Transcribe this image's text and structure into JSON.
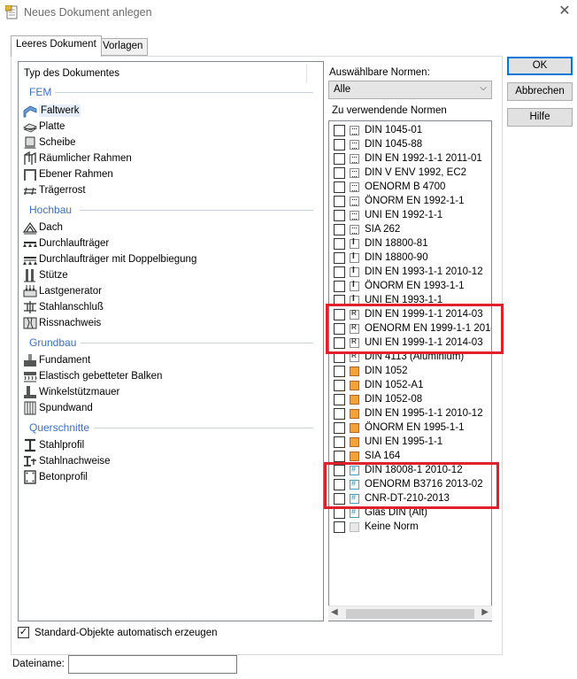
{
  "window": {
    "title": "Neues Dokument anlegen",
    "close_glyph": "✕"
  },
  "tabs": [
    {
      "label": "Leeres Dokument"
    },
    {
      "label": "Vorlagen"
    }
  ],
  "tree": {
    "header": "Typ des Dokumentes",
    "groups": [
      {
        "label": "FEM",
        "items": [
          "Faltwerk",
          "Platte",
          "Scheibe",
          "Räumlicher Rahmen",
          "Ebener Rahmen",
          "Trägerrost"
        ]
      },
      {
        "label": "Hochbau",
        "items": [
          "Dach",
          "Durchlaufträger",
          "Durchlaufträger mit Doppelbiegung",
          "Stütze",
          "Lastgenerator",
          "Stahlanschluß",
          "Rissnachweis"
        ]
      },
      {
        "label": "Grundbau",
        "items": [
          "Fundament",
          "Elastisch gebetteter Balken",
          "Winkelstützmauer",
          "Spundwand"
        ]
      },
      {
        "label": "Querschnitte",
        "items": [
          "Stahlprofil",
          "Stahlnachweise",
          "Betonprofil"
        ]
      }
    ],
    "selected": "Faltwerk"
  },
  "norms": {
    "available_label": "Auswählbare Normen:",
    "available_value": "Alle",
    "used_label": "Zu verwendende Normen",
    "items": [
      {
        "label": "DIN 1045-01",
        "icon": "concrete-icon"
      },
      {
        "label": "DIN 1045-88",
        "icon": "concrete-icon"
      },
      {
        "label": "DIN EN 1992-1-1 2011-01",
        "icon": "concrete-icon"
      },
      {
        "label": "DIN V ENV 1992, EC2",
        "icon": "concrete-icon"
      },
      {
        "label": "OENORM B 4700",
        "icon": "concrete-icon"
      },
      {
        "label": "ÖNORM EN 1992-1-1",
        "icon": "concrete-icon"
      },
      {
        "label": "UNI EN 1992-1-1",
        "icon": "concrete-icon"
      },
      {
        "label": "SIA 262",
        "icon": "concrete-icon"
      },
      {
        "label": "DIN 18800-81",
        "icon": "steel-icon"
      },
      {
        "label": "DIN 18800-90",
        "icon": "steel-icon"
      },
      {
        "label": "DIN EN 1993-1-1 2010-12",
        "icon": "steel-icon"
      },
      {
        "label": "ÖNORM EN 1993-1-1",
        "icon": "steel-icon"
      },
      {
        "label": "UNI EN 1993-1-1",
        "icon": "steel-icon"
      },
      {
        "label": "DIN EN 1999-1-1 2014-03",
        "icon": "aluminium-icon"
      },
      {
        "label": "OENORM EN 1999-1-1 2014-0",
        "icon": "aluminium-icon"
      },
      {
        "label": "UNI EN 1999-1-1 2014-03",
        "icon": "aluminium-icon"
      },
      {
        "label": "DIN 4113 (Aluminium)",
        "icon": "aluminium-icon"
      },
      {
        "label": "DIN 1052",
        "icon": "timber-icon"
      },
      {
        "label": "DIN 1052-A1",
        "icon": "timber-icon"
      },
      {
        "label": "DIN 1052-08",
        "icon": "timber-icon"
      },
      {
        "label": "DIN EN 1995-1-1 2010-12",
        "icon": "timber-icon"
      },
      {
        "label": "ÖNORM EN 1995-1-1",
        "icon": "timber-icon"
      },
      {
        "label": "UNI EN 1995-1-1",
        "icon": "timber-icon"
      },
      {
        "label": "SIA 164",
        "icon": "timber-icon"
      },
      {
        "label": "DIN 18008-1 2010-12",
        "icon": "glass-icon"
      },
      {
        "label": "OENORM B3716 2013-02",
        "icon": "glass-icon"
      },
      {
        "label": "CNR-DT-210-2013",
        "icon": "glass-icon"
      },
      {
        "label": "Glas DIN (Alt)",
        "icon": "glass-icon"
      },
      {
        "label": "Keine Norm",
        "icon": "none-icon"
      }
    ]
  },
  "buttons": {
    "ok": "OK",
    "cancel": "Abbrechen",
    "help": "Hilfe"
  },
  "auto_create": {
    "label": "Standard-Objekte automatisch erzeugen",
    "checked": true,
    "check_glyph": "✓"
  },
  "filename": {
    "label": "Dateiname:",
    "value": ""
  },
  "highlight_color": "#e0202a"
}
